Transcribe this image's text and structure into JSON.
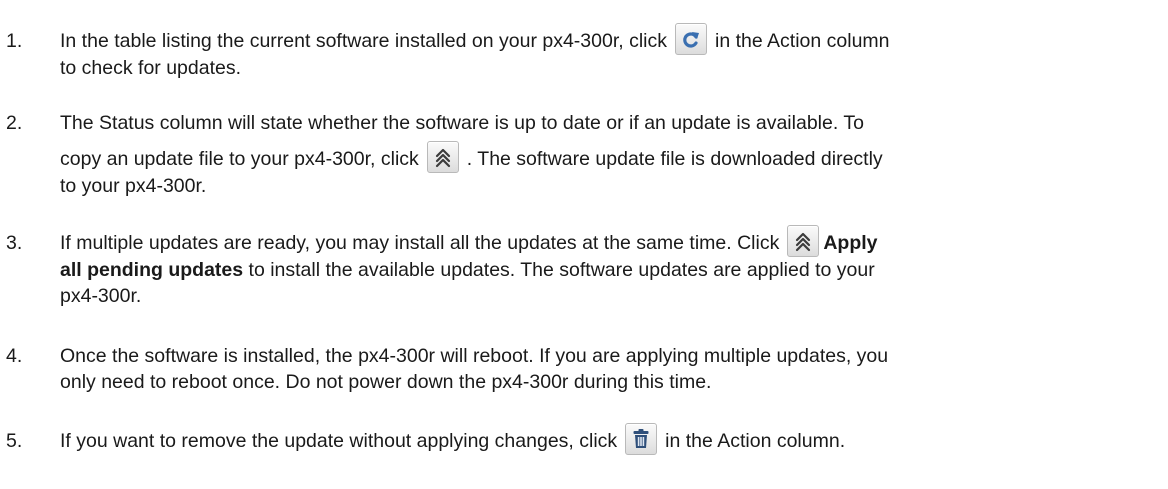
{
  "steps": [
    {
      "number": "1.",
      "text_a": "In the table listing the current software installed on your px4-300r, click",
      "text_b": "in the Action column",
      "text_c": "to check for updates.",
      "icon": "refresh-icon"
    },
    {
      "number": "2.",
      "text_a": "The Status column will state whether the software is up to date or if an update is available. To",
      "text_b": "copy an update file to your px4-300r, click",
      "text_c": ". The software update file is downloaded directly",
      "text_d": "to your px4-300r.",
      "icon": "update-arrows-icon"
    },
    {
      "number": "3.",
      "text_a": "If multiple updates are ready, you may install all the updates at the same time. Click",
      "bold_label": "Apply",
      "bold_label_2": "all pending updates",
      "text_b": "to install the available updates. The software updates are applied to your",
      "text_c": "px4-300r.",
      "icon": "update-arrows-icon"
    },
    {
      "number": "4.",
      "text_a": "Once the software is installed, the px4-300r will reboot. If you are applying multiple updates, you",
      "text_b": "only need to reboot once. Do not power down the px4-300r during this time."
    },
    {
      "number": "5.",
      "text_a": "If you want to remove the update without applying changes, click",
      "text_b": "in the Action column.",
      "icon": "trash-icon"
    }
  ],
  "colors": {
    "text": "#1a1a1a",
    "icon_blue": "#3a6fb0",
    "icon_dark": "#3c3c3c"
  }
}
